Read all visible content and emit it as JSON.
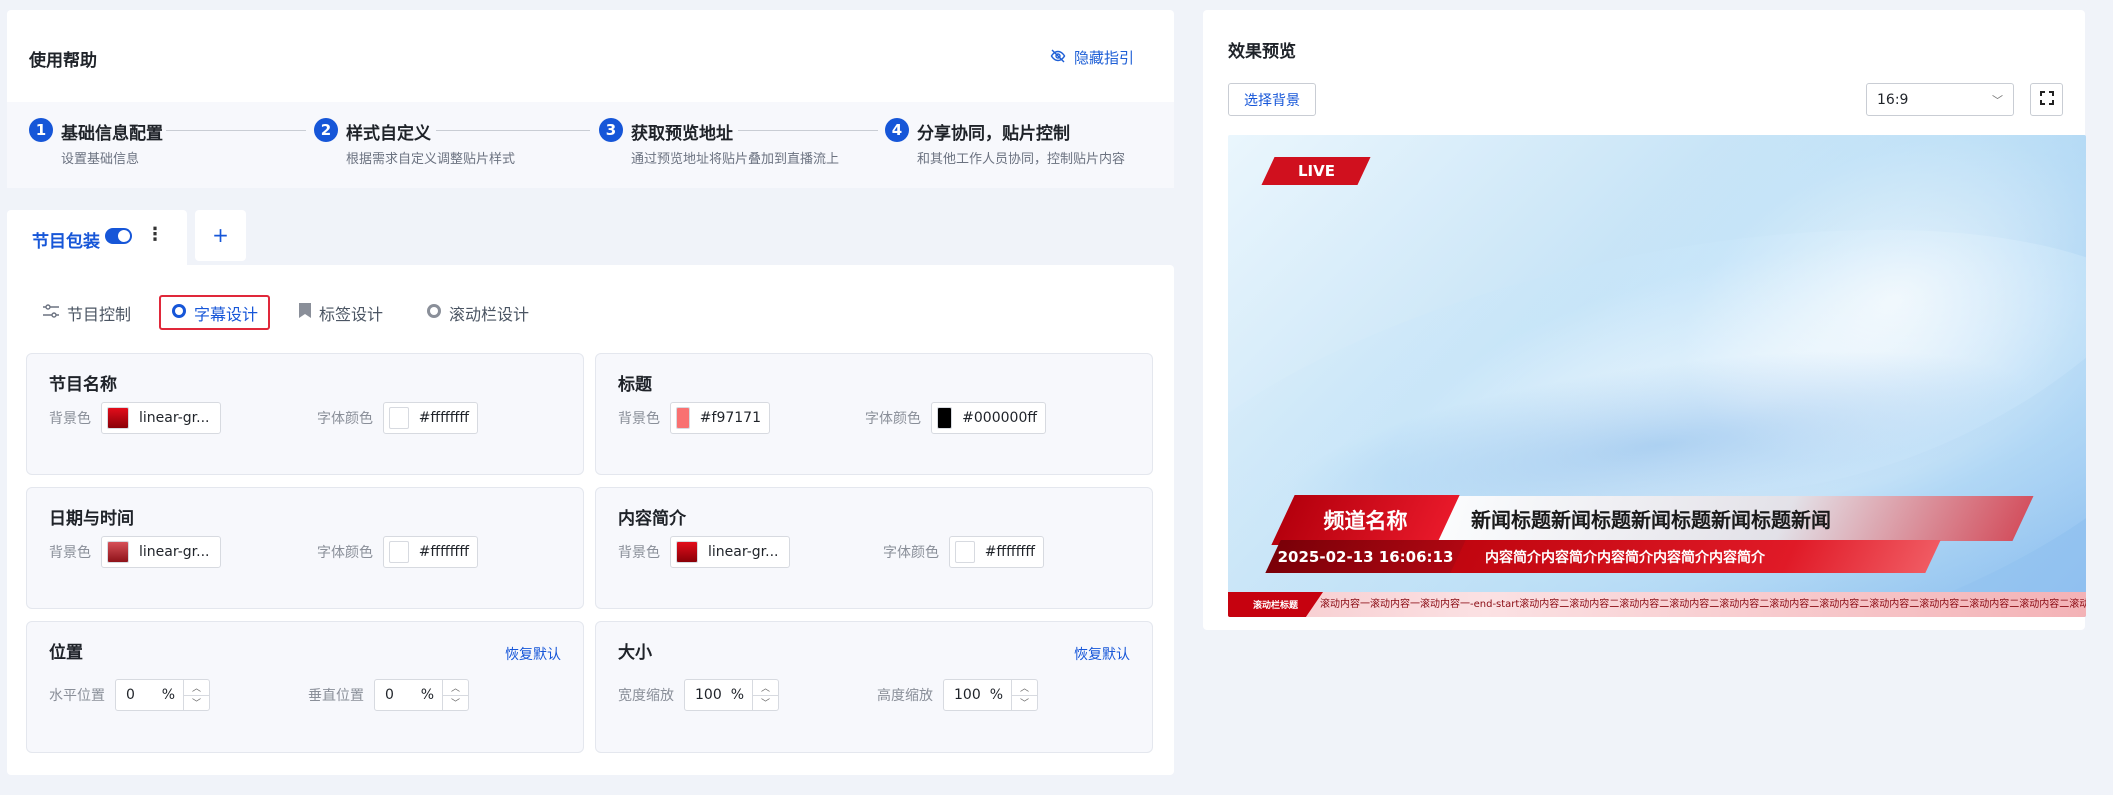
{
  "help": {
    "title": "使用帮助",
    "hide_guide": "隐藏指引",
    "steps": [
      {
        "num": "1",
        "label": "基础信息配置",
        "desc": "设置基础信息"
      },
      {
        "num": "2",
        "label": "样式自定义",
        "desc": "根据需求自定义调整贴片样式"
      },
      {
        "num": "3",
        "label": "获取预览地址",
        "desc": "通过预览地址将贴片叠加到直播流上"
      },
      {
        "num": "4",
        "label": "分享协同，贴片控制",
        "desc": "和其他工作人员协同，控制贴片内容"
      }
    ]
  },
  "program_tab": {
    "label": "节目包装",
    "toggle_on": true,
    "more": "⋮",
    "add": "+"
  },
  "subtabs": [
    {
      "label": "节目控制",
      "active": false
    },
    {
      "label": "字幕设计",
      "active": true
    },
    {
      "label": "标签设计",
      "active": false
    },
    {
      "label": "滚动栏设计",
      "active": false
    }
  ],
  "cards": {
    "program_name": {
      "title": "节目名称",
      "bg_label": "背景色",
      "bg_value": "linear-gr...",
      "bg_color": "#c5000c",
      "font_label": "字体颜色",
      "font_value": "#ffffffff",
      "font_color": "#ffffff"
    },
    "headline": {
      "title": "标题",
      "bg_label": "背景色",
      "bg_value": "#f97171",
      "bg_color": "#f97171",
      "font_label": "字体颜色",
      "font_value": "#000000ff",
      "font_color": "#000000"
    },
    "datetime": {
      "title": "日期与时间",
      "bg_label": "背景色",
      "bg_value": "linear-gr...",
      "bg_color": "#a8262f",
      "font_label": "字体颜色",
      "font_value": "#ffffffff",
      "font_color": "#ffffff"
    },
    "intro": {
      "title": "内容简介",
      "bg_label": "背景色",
      "bg_value": "linear-gr...",
      "bg_color": "#c5000c",
      "font_label": "字体颜色",
      "font_value": "#ffffffff",
      "font_color": "#ffffff"
    },
    "position": {
      "title": "位置",
      "reset": "恢复默认",
      "h_label": "水平位置",
      "h_value": "0",
      "v_label": "垂直位置",
      "v_value": "0",
      "unit": "%"
    },
    "size": {
      "title": "大小",
      "reset": "恢复默认",
      "w_label": "宽度缩放",
      "w_value": "100",
      "h_label": "高度缩放",
      "h_value": "100",
      "unit": "%"
    }
  },
  "preview": {
    "title": "效果预览",
    "select_bg": "选择背景",
    "ratio": "16:9",
    "live": "LIVE",
    "channel": "频道名称",
    "headline": "新闻标题新闻标题新闻标题新闻标题新闻",
    "datetime": "2025-02-13 16:06:13",
    "intro": "内容简介内容简介内容简介内容简介内容简介",
    "ticker_label": "滚动栏标题",
    "ticker_text1": "滚动内容一滚动内容一滚动内容一-end-",
    "ticker_text2": "start滚动内容二滚动内容二滚动内容二滚动内容二滚动内容二滚动内容二滚动内容二滚动内容二滚动内容二滚动内容二滚动内容二滚动内容二"
  },
  "colors": {
    "accent": "#1656d8",
    "highlight_border": "#e0283a",
    "live_red": "#d0101e"
  }
}
